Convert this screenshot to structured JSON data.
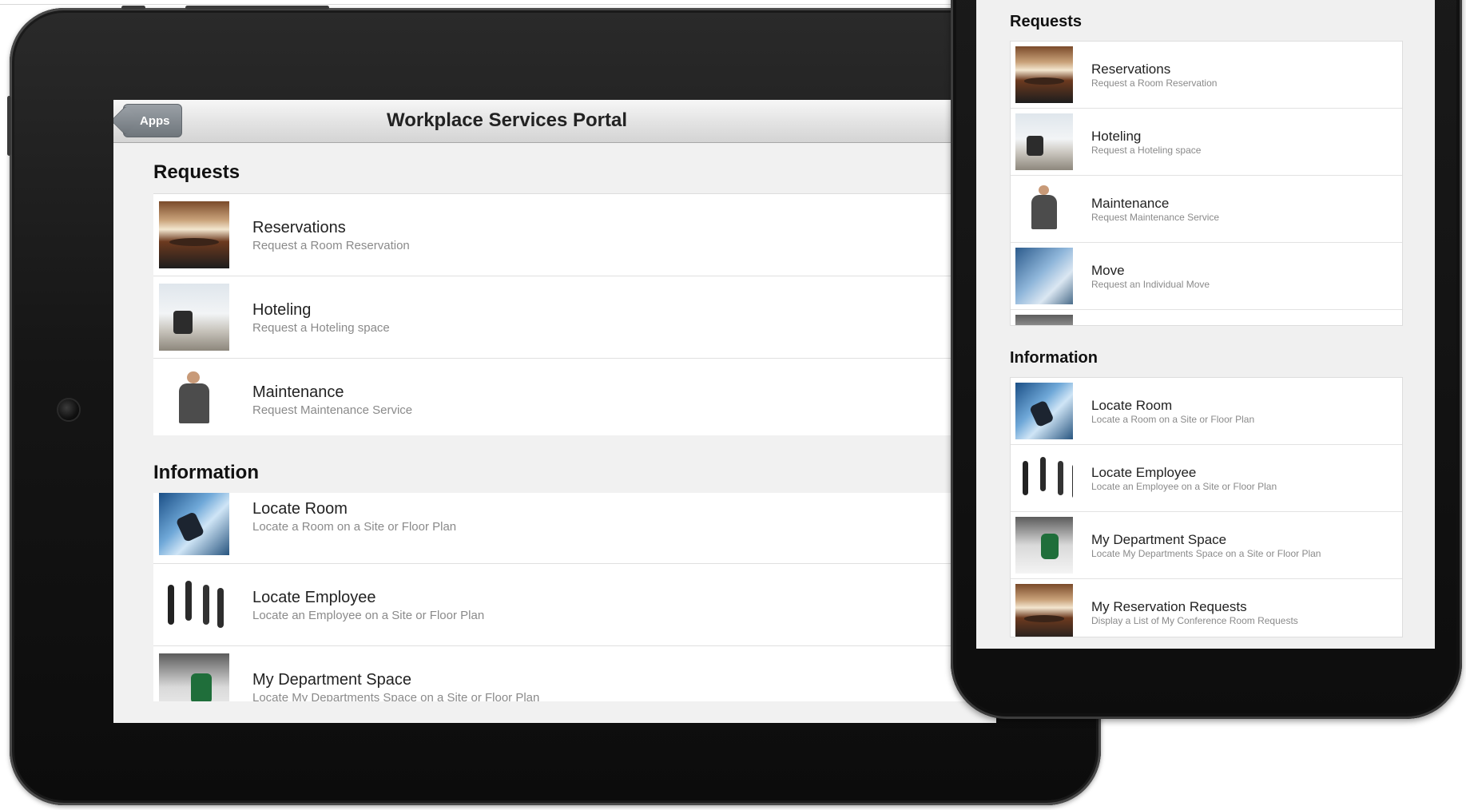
{
  "tablet": {
    "back_label": "Apps",
    "title": "Workplace Services Portal",
    "sections": {
      "requests": {
        "title": "Requests",
        "items": [
          {
            "name": "Reservations",
            "desc": "Request a Room Reservation",
            "icon": "conference-room-thumbnail"
          },
          {
            "name": "Hoteling",
            "desc": "Request a Hoteling space",
            "icon": "office-desk-thumbnail"
          },
          {
            "name": "Maintenance",
            "desc": "Request Maintenance Service",
            "icon": "maintenance-worker-thumbnail"
          }
        ]
      },
      "information": {
        "title": "Information",
        "items": [
          {
            "name": "Locate Room",
            "desc": "Locate a Room on a Site or Floor Plan",
            "icon": "locate-room-thumbnail"
          },
          {
            "name": "Locate Employee",
            "desc": "Locate an Employee on a Site or Floor Plan",
            "icon": "locate-employee-thumbnail"
          },
          {
            "name": "My Department Space",
            "desc": "Locate My Departments Space on a Site or Floor Plan",
            "icon": "department-space-thumbnail"
          }
        ]
      }
    }
  },
  "phone": {
    "sections": {
      "requests": {
        "title": "Requests",
        "items": [
          {
            "name": "Reservations",
            "desc": "Request a Room Reservation",
            "icon": "conference-room-thumbnail"
          },
          {
            "name": "Hoteling",
            "desc": "Request a Hoteling space",
            "icon": "office-desk-thumbnail"
          },
          {
            "name": "Maintenance",
            "desc": "Request Maintenance Service",
            "icon": "maintenance-worker-thumbnail"
          },
          {
            "name": "Move",
            "desc": "Request an Individual Move",
            "icon": "move-thumbnail"
          }
        ]
      },
      "information": {
        "title": "Information",
        "items": [
          {
            "name": "Locate Room",
            "desc": "Locate a Room on a Site or Floor Plan",
            "icon": "locate-room-thumbnail"
          },
          {
            "name": "Locate Employee",
            "desc": "Locate an Employee on a Site or Floor Plan",
            "icon": "locate-employee-thumbnail"
          },
          {
            "name": "My Department Space",
            "desc": "Locate My Departments Space on a Site or Floor Plan",
            "icon": "department-space-thumbnail"
          },
          {
            "name": "My Reservation Requests",
            "desc": "Display a List of My Conference Room Requests",
            "icon": "conference-room-thumbnail"
          }
        ]
      }
    }
  }
}
